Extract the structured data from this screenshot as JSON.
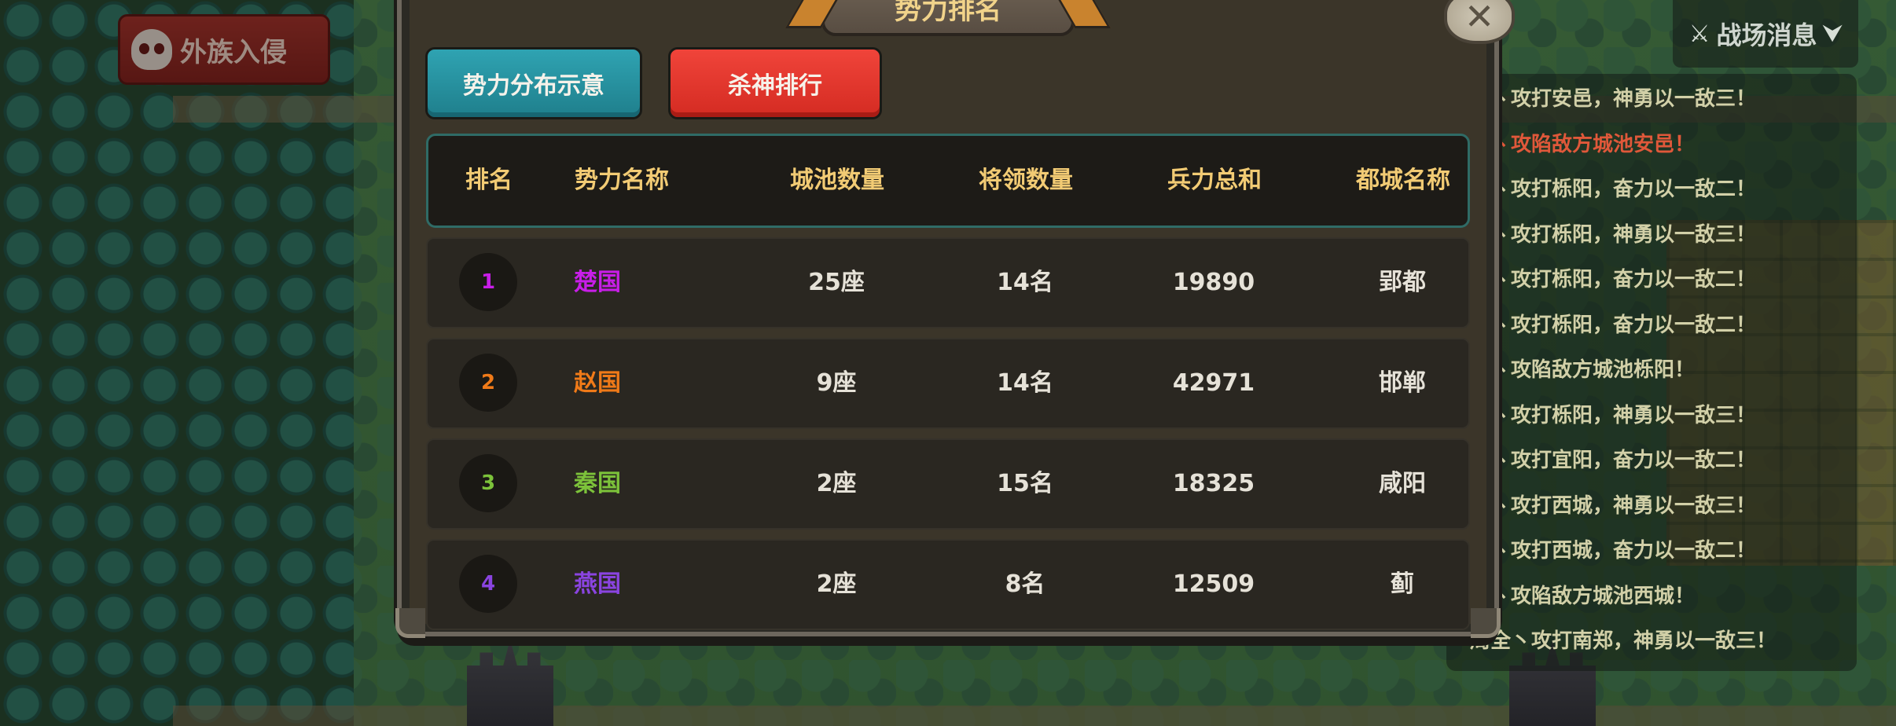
{
  "invasion_button": {
    "label": "外族入侵"
  },
  "battle_news": {
    "toggle_label": "战场消息",
    "lines": [
      {
        "text": "全丶攻打安邑，神勇以一敌三！",
        "color": "#d2d0a8"
      },
      {
        "text": "全丶攻陷敌方城池安邑！",
        "color": "#e0583a"
      },
      {
        "text": "全丶攻打栎阳，奋力以一敌二！",
        "color": "#d2d0a8"
      },
      {
        "text": "全丶攻打栎阳，神勇以一敌三！",
        "color": "#d2d0a8"
      },
      {
        "text": "全丶攻打栎阳，奋力以一敌二！",
        "color": "#d2d0a8"
      },
      {
        "text": "全丶攻打栎阳，奋力以一敌二！",
        "color": "#d2d0a8"
      },
      {
        "text": "全丶攻陷敌方城池栎阳！",
        "color": "#d2d0a8"
      },
      {
        "text": "全丶攻打栎阳，神勇以一敌三！",
        "color": "#d2d0a8"
      },
      {
        "text": "全丶攻打宜阳，奋力以一敌二！",
        "color": "#d2d0a8"
      },
      {
        "text": "全丶攻打西城，神勇以一敌三！",
        "color": "#d2d0a8"
      },
      {
        "text": "全丶攻打西城，奋力以一敌二！",
        "color": "#d2d0a8"
      },
      {
        "text": "全丶攻陷敌方城池西城！",
        "color": "#d2d0a8"
      },
      {
        "text": "周全丶攻打南郑，神勇以一敌三！",
        "color": "#d2d0a8"
      }
    ]
  },
  "modal": {
    "title": "势力排名",
    "close_icon": "close-x-icon",
    "tabs": [
      {
        "label": "势力分布示意",
        "color": "#2fa3b2"
      },
      {
        "label": "杀神排行",
        "color": "#f0443a"
      }
    ],
    "table": {
      "headers": [
        "排名",
        "势力名称",
        "城池数量",
        "将领数量",
        "兵力总和",
        "都城名称"
      ],
      "rows": [
        {
          "rank": "1",
          "name": "楚国",
          "cities": "25座",
          "generals": "14名",
          "troops": "19890",
          "capital": "郢都",
          "color": "#c81ee8"
        },
        {
          "rank": "2",
          "name": "赵国",
          "cities": "9座",
          "generals": "14名",
          "troops": "42971",
          "capital": "邯郸",
          "color": "#f07a18"
        },
        {
          "rank": "3",
          "name": "秦国",
          "cities": "2座",
          "generals": "15名",
          "troops": "18325",
          "capital": "咸阳",
          "color": "#7cc23a"
        },
        {
          "rank": "4",
          "name": "燕国",
          "cities": "2座",
          "generals": "8名",
          "troops": "12509",
          "capital": "蓟",
          "color": "#8a44e0"
        }
      ]
    }
  }
}
